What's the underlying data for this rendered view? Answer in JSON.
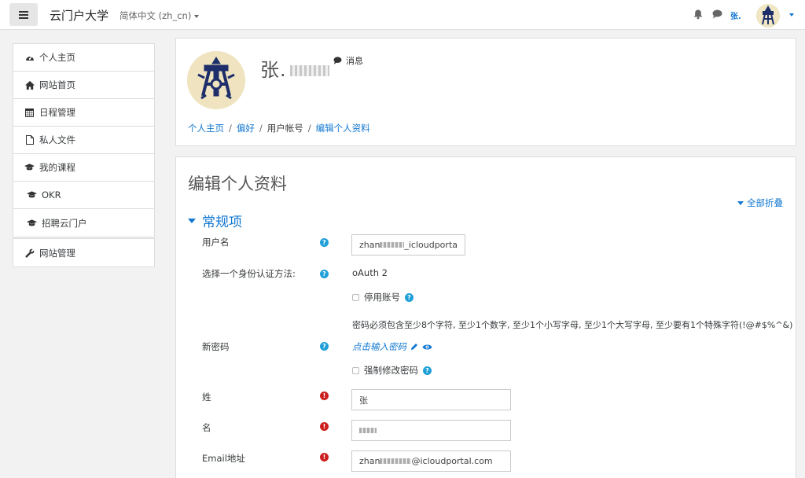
{
  "navbar": {
    "menu_icon": "hamburger-icon",
    "site_name": "云门户大学",
    "language": "简体中文 (zh_cn)",
    "user_short": "张.",
    "icons": [
      "bell-icon",
      "chat-icon"
    ]
  },
  "sidebar": {
    "group1": [
      {
        "icon": "dashboard-icon",
        "label": "个人主页"
      },
      {
        "icon": "home-icon",
        "label": "网站首页"
      },
      {
        "icon": "calendar-icon",
        "label": "日程管理"
      },
      {
        "icon": "file-icon",
        "label": "私人文件"
      },
      {
        "icon": "graduation-cap-icon",
        "label": "我的课程"
      },
      {
        "icon": "graduation-cap-icon",
        "label": "OKR"
      },
      {
        "icon": "graduation-cap-icon",
        "label": "招聘云门户"
      }
    ],
    "group2": [
      {
        "icon": "wrench-icon",
        "label": "网站管理"
      }
    ]
  },
  "profile": {
    "name": "张.",
    "message_label": "消息",
    "breadcrumb": [
      "个人主页",
      "偏好",
      "用户帐号",
      "编辑个人资料"
    ]
  },
  "form": {
    "title": "编辑个人资料",
    "collapse_all": "全部折叠",
    "section_general": "常规项",
    "username_label": "用户名",
    "username_value": "zhan",
    "username_suffix": "_icloudporta",
    "auth_label": "选择一个身份认证方法:",
    "auth_value": "oAuth 2",
    "suspend_label": "停用账号",
    "password_rule": "密码必须包含至少8个字符, 至少1个数字, 至少1个小写字母, 至少1个大写字母, 至少要有1个特殊字符(!@#$%^&)",
    "new_password_label": "新密码",
    "click_to_enter": "点击输入密码",
    "force_change_label": "强制修改密码",
    "surname_label": "姓",
    "surname_value": "张",
    "firstname_label": "名",
    "email_label": "Email地址",
    "email_prefix": "zhan",
    "email_suffix": "@icloudportal.com"
  },
  "colors": {
    "accent": "#1177d1",
    "help": "#1e9fd8",
    "required": "#cc1f1f"
  }
}
